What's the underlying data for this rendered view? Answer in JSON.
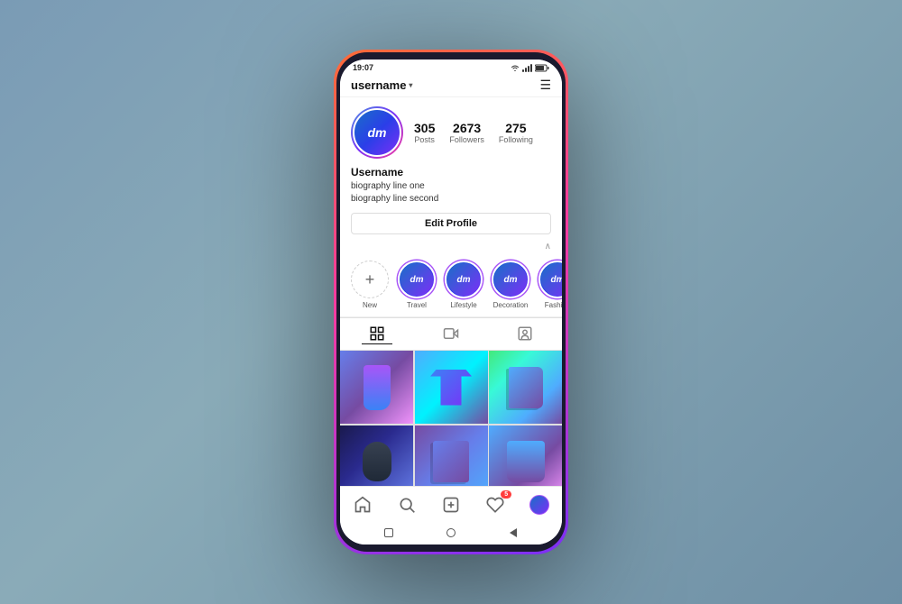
{
  "phone": {
    "status": {
      "time": "19:07"
    },
    "topBar": {
      "username": "username",
      "dropdownLabel": "▾",
      "menuLabel": "☰"
    },
    "profile": {
      "displayName": "Username",
      "bioLine1": "biography line one",
      "bioLine2": "biography line second",
      "stats": {
        "posts": {
          "count": "305",
          "label": "Posts"
        },
        "followers": {
          "count": "2673",
          "label": "Followers"
        },
        "following": {
          "count": "275",
          "label": "Following"
        }
      },
      "editProfileBtn": "Edit Profile"
    },
    "stories": [
      {
        "type": "new",
        "label": "New"
      },
      {
        "type": "filled",
        "label": "Travel"
      },
      {
        "type": "filled",
        "label": "Lifestyle"
      },
      {
        "type": "filled",
        "label": "Decoration"
      },
      {
        "type": "filled",
        "label": "Fashion"
      }
    ],
    "tabs": [
      {
        "icon": "grid",
        "active": true
      },
      {
        "icon": "video",
        "active": false
      },
      {
        "icon": "tag",
        "active": false
      }
    ],
    "grid": [
      {
        "id": 1,
        "product": "socks"
      },
      {
        "id": 2,
        "product": "tshirt"
      },
      {
        "id": 3,
        "product": "books"
      },
      {
        "id": 4,
        "product": "mouse"
      },
      {
        "id": 5,
        "product": "notebook"
      },
      {
        "id": 6,
        "product": "bag"
      }
    ],
    "bottomNav": [
      {
        "icon": "home",
        "active": false
      },
      {
        "icon": "search",
        "active": false
      },
      {
        "icon": "plus",
        "active": false
      },
      {
        "icon": "heart",
        "active": false,
        "badge": "5"
      },
      {
        "icon": "profile",
        "active": true
      }
    ],
    "androidNav": {
      "back": "back",
      "home": "home",
      "recent": "recent"
    }
  }
}
